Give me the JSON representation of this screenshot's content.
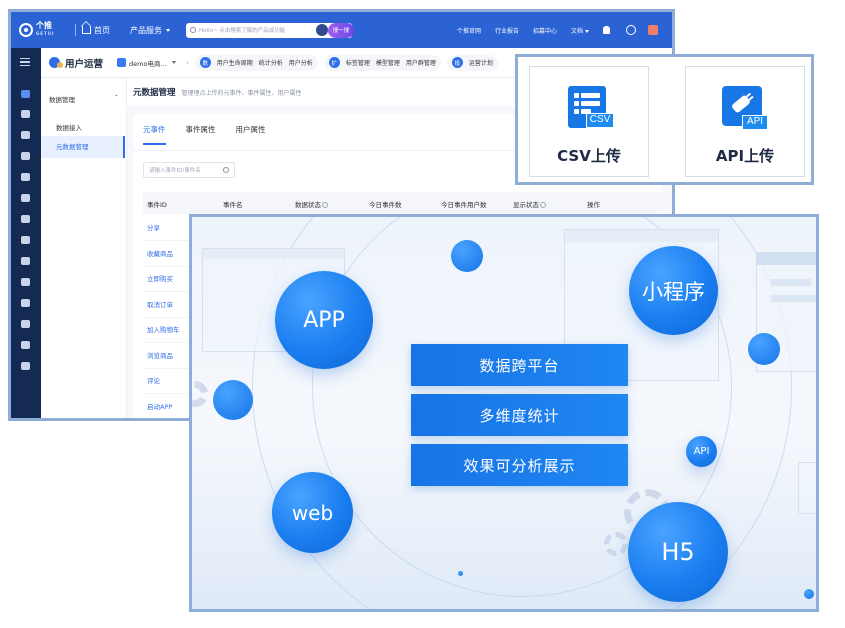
{
  "admin": {
    "topbar": {
      "logo": "个推",
      "logo_sub": "GETUI",
      "home": "首页",
      "products": "产品服务",
      "search_placeholder": "Hello~ 点击搜索了解的产品或功能",
      "search_button": "搜一搜",
      "links": [
        "个推官网",
        "行业报告",
        "招募中心",
        "文档"
      ]
    },
    "subbar": {
      "title": "用户运营",
      "app": "demo电商…",
      "groups": [
        {
          "badge": "数",
          "items": [
            "用户生命周期",
            "统计分析",
            "用户分析"
          ]
        },
        {
          "badge": "扩",
          "items": [
            "标签管理",
            "模型管理",
            "用户群管理"
          ]
        },
        {
          "badge": "投",
          "items": [
            "运营计划"
          ]
        }
      ]
    },
    "leftnav": {
      "group": "数据管理",
      "items": [
        "数据接入",
        "元数据管理"
      ]
    },
    "content": {
      "title": "元数据管理",
      "desc": "管理埋点上传的元事件、事件属性、用户属性",
      "tabs": [
        "元事件",
        "事件属性",
        "用户属性"
      ],
      "search_placeholder": "请输入事件ID/事件名",
      "columns": [
        "事件ID",
        "事件名",
        "数据状态",
        "今日事件数",
        "今日事件用户数",
        "显示状态",
        "操作"
      ],
      "rows": [
        "分享",
        "收藏商品",
        "立即购买",
        "取消订单",
        "加入购物车",
        "浏览商品",
        "评论",
        "启动APP"
      ]
    }
  },
  "upload": {
    "csv_label": "CSV上传",
    "csv_tag": "CSV",
    "api_label": "API上传",
    "api_tag": "API"
  },
  "illustration": {
    "bubbles": {
      "app": "APP",
      "mini": "小程序",
      "web": "web",
      "h5": "H5",
      "api": "API"
    },
    "features": [
      "数据跨平台",
      "多维度统计",
      "效果可分析展示"
    ]
  }
}
